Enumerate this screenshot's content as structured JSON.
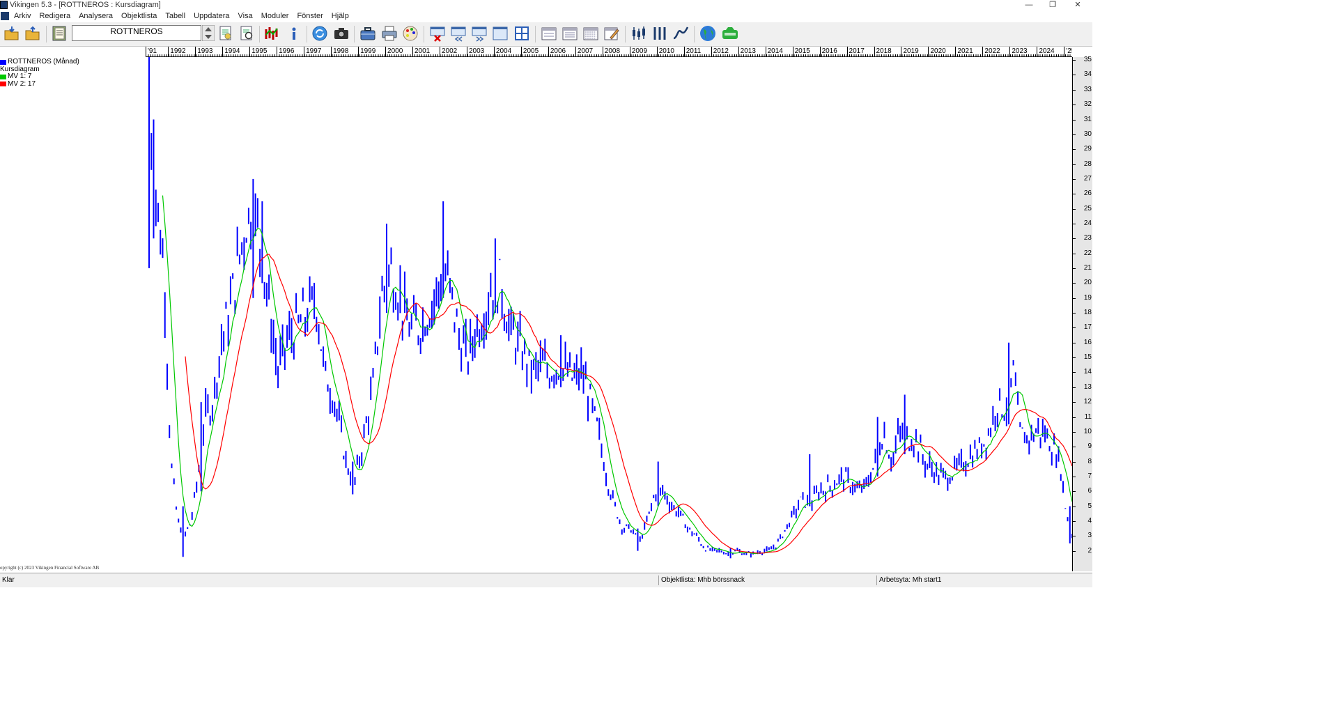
{
  "window": {
    "title": "Vikingen 5.3 - [ROTTNEROS : Kursdiagram]"
  },
  "menu": {
    "items": [
      "Arkiv",
      "Redigera",
      "Analysera",
      "Objektlista",
      "Tabell",
      "Uppdatera",
      "Visa",
      "Moduler",
      "Fönster",
      "Hjälp"
    ]
  },
  "toolbar": {
    "instrument": "ROTTNEROS",
    "icons": [
      "folder-open-icon",
      "folder-up-icon",
      "notebook-icon",
      "list-document-icon",
      "list-star-icon",
      "candles-chart-icon",
      "info-icon",
      "refresh-icon",
      "camera-icon",
      "briefcase-icon",
      "printer-icon",
      "palette-icon",
      "window-close-icon",
      "window-back-icon",
      "window-forward-icon",
      "window-icon",
      "number-grid-icon",
      "calendar-day-icon",
      "calendar-week-icon",
      "calendar-month-icon",
      "calendar-edit-icon",
      "bar-candles-icon",
      "bar-ohlc-icon",
      "line-curve-icon",
      "globe-icon",
      "web-icon"
    ]
  },
  "chart_data": {
    "type": "line",
    "title": "",
    "xlabel": "",
    "ylabel": "",
    "ylim": [
      1,
      36
    ],
    "year_labels": [
      "'91",
      "1992",
      "1993",
      "1994",
      "1995",
      "1996",
      "1997",
      "1998",
      "1999",
      "2000",
      "2001",
      "2002",
      "2003",
      "2004",
      "2005",
      "2006",
      "2007",
      "2008",
      "2009",
      "2010",
      "2011",
      "2012",
      "2013",
      "2014",
      "2015",
      "2016",
      "2017",
      "2018",
      "2019",
      "2020",
      "2021",
      "2022",
      "2023",
      "2024",
      "'25"
    ],
    "y_ticks": [
      2,
      3,
      4,
      5,
      6,
      7,
      8,
      9,
      10,
      11,
      12,
      13,
      14,
      15,
      16,
      17,
      18,
      19,
      20,
      21,
      22,
      23,
      24,
      25,
      26,
      27,
      28,
      29,
      30,
      31,
      32,
      33,
      34,
      35
    ],
    "legend": [
      "ROTTNEROS (Månad)",
      "Kursdiagram",
      "MV 1: 7",
      "MV 2: 17"
    ],
    "colors": {
      "price": "#0000ff",
      "mv1": "#00c800",
      "mv2": "#ff0000"
    },
    "anchors": [
      {
        "t": 1991.1,
        "c": 31
      },
      {
        "t": 1991.3,
        "c": 26
      },
      {
        "t": 1991.6,
        "c": 21
      },
      {
        "t": 1991.85,
        "c": 8
      },
      {
        "t": 1992.1,
        "c": 4
      },
      {
        "t": 1992.35,
        "c": 3
      },
      {
        "t": 1992.6,
        "c": 4
      },
      {
        "t": 1992.85,
        "c": 7
      },
      {
        "t": 1993.1,
        "c": 11
      },
      {
        "t": 1993.4,
        "c": 12
      },
      {
        "t": 1993.7,
        "c": 16
      },
      {
        "t": 1994.0,
        "c": 18
      },
      {
        "t": 1994.3,
        "c": 21
      },
      {
        "t": 1994.6,
        "c": 24
      },
      {
        "t": 1994.9,
        "c": 25
      },
      {
        "t": 1995.2,
        "c": 22
      },
      {
        "t": 1995.5,
        "c": 18
      },
      {
        "t": 1995.8,
        "c": 14
      },
      {
        "t": 1996.1,
        "c": 16
      },
      {
        "t": 1996.5,
        "c": 17
      },
      {
        "t": 1996.9,
        "c": 18
      },
      {
        "t": 1997.2,
        "c": 19
      },
      {
        "t": 1997.5,
        "c": 14
      },
      {
        "t": 1997.9,
        "c": 12
      },
      {
        "t": 1998.3,
        "c": 8
      },
      {
        "t": 1998.6,
        "c": 6.5
      },
      {
        "t": 1998.9,
        "c": 9
      },
      {
        "t": 1999.3,
        "c": 13
      },
      {
        "t": 1999.6,
        "c": 19
      },
      {
        "t": 1999.95,
        "c": 21
      },
      {
        "t": 2000.3,
        "c": 19
      },
      {
        "t": 2000.6,
        "c": 17
      },
      {
        "t": 2001.0,
        "c": 17
      },
      {
        "t": 2001.3,
        "c": 18
      },
      {
        "t": 2001.6,
        "c": 19
      },
      {
        "t": 2001.9,
        "c": 21
      },
      {
        "t": 2002.2,
        "c": 19
      },
      {
        "t": 2002.5,
        "c": 16
      },
      {
        "t": 2002.8,
        "c": 15
      },
      {
        "t": 2003.1,
        "c": 17
      },
      {
        "t": 2003.4,
        "c": 18
      },
      {
        "t": 2003.7,
        "c": 20
      },
      {
        "t": 2004.0,
        "c": 20
      },
      {
        "t": 2004.3,
        "c": 17
      },
      {
        "t": 2004.6,
        "c": 16
      },
      {
        "t": 2004.9,
        "c": 15
      },
      {
        "t": 2005.2,
        "c": 14
      },
      {
        "t": 2005.5,
        "c": 14.5
      },
      {
        "t": 2005.8,
        "c": 14
      },
      {
        "t": 2006.1,
        "c": 14.5
      },
      {
        "t": 2006.4,
        "c": 14
      },
      {
        "t": 2006.7,
        "c": 13.5
      },
      {
        "t": 2007.0,
        "c": 14
      },
      {
        "t": 2007.3,
        "c": 12
      },
      {
        "t": 2007.6,
        "c": 10
      },
      {
        "t": 2007.9,
        "c": 7
      },
      {
        "t": 2008.2,
        "c": 5
      },
      {
        "t": 2008.5,
        "c": 3.5
      },
      {
        "t": 2008.8,
        "c": 3.5
      },
      {
        "t": 2009.1,
        "c": 2.5
      },
      {
        "t": 2009.4,
        "c": 4
      },
      {
        "t": 2009.7,
        "c": 6
      },
      {
        "t": 2010.0,
        "c": 6
      },
      {
        "t": 2010.3,
        "c": 5
      },
      {
        "t": 2010.6,
        "c": 4.5
      },
      {
        "t": 2010.9,
        "c": 3.5
      },
      {
        "t": 2011.2,
        "c": 3
      },
      {
        "t": 2011.5,
        "c": 2.2
      },
      {
        "t": 2011.8,
        "c": 2
      },
      {
        "t": 2012.1,
        "c": 2
      },
      {
        "t": 2012.4,
        "c": 1.8
      },
      {
        "t": 2012.7,
        "c": 2
      },
      {
        "t": 2013.0,
        "c": 1.8
      },
      {
        "t": 2013.3,
        "c": 1.8
      },
      {
        "t": 2013.6,
        "c": 2
      },
      {
        "t": 2013.9,
        "c": 2
      },
      {
        "t": 2014.2,
        "c": 2.5
      },
      {
        "t": 2014.5,
        "c": 3.5
      },
      {
        "t": 2014.8,
        "c": 4.5
      },
      {
        "t": 2015.1,
        "c": 5.5
      },
      {
        "t": 2015.4,
        "c": 5
      },
      {
        "t": 2015.7,
        "c": 6
      },
      {
        "t": 2016.0,
        "c": 6.2
      },
      {
        "t": 2016.3,
        "c": 6.5
      },
      {
        "t": 2016.6,
        "c": 7
      },
      {
        "t": 2016.9,
        "c": 6.5
      },
      {
        "t": 2017.2,
        "c": 6
      },
      {
        "t": 2017.5,
        "c": 6.5
      },
      {
        "t": 2017.8,
        "c": 8
      },
      {
        "t": 2018.1,
        "c": 10
      },
      {
        "t": 2018.4,
        "c": 8
      },
      {
        "t": 2018.7,
        "c": 10
      },
      {
        "t": 2019.0,
        "c": 9.5
      },
      {
        "t": 2019.3,
        "c": 9.5
      },
      {
        "t": 2019.6,
        "c": 8
      },
      {
        "t": 2019.9,
        "c": 7.5
      },
      {
        "t": 2020.2,
        "c": 7
      },
      {
        "t": 2020.5,
        "c": 7
      },
      {
        "t": 2020.8,
        "c": 7.5
      },
      {
        "t": 2021.1,
        "c": 8
      },
      {
        "t": 2021.4,
        "c": 8.5
      },
      {
        "t": 2021.7,
        "c": 9
      },
      {
        "t": 2022.0,
        "c": 10
      },
      {
        "t": 2022.3,
        "c": 12
      },
      {
        "t": 2022.6,
        "c": 11.5
      },
      {
        "t": 2022.9,
        "c": 14
      },
      {
        "t": 2023.1,
        "c": 10
      },
      {
        "t": 2023.4,
        "c": 9.5
      },
      {
        "t": 2023.7,
        "c": 10
      },
      {
        "t": 2024.0,
        "c": 10
      },
      {
        "t": 2024.3,
        "c": 9
      },
      {
        "t": 2024.6,
        "c": 8
      },
      {
        "t": 2024.8,
        "c": 5
      },
      {
        "t": 2025.0,
        "c": 3
      }
    ],
    "spikes": [
      {
        "t": 1991.05,
        "h": 35.5,
        "l": 21
      },
      {
        "t": 1991.25,
        "h": 31,
        "l": 23
      },
      {
        "t": 1992.3,
        "h": 5,
        "l": 1.6
      },
      {
        "t": 1993.0,
        "h": 12,
        "l": 6
      },
      {
        "t": 1994.85,
        "h": 27,
        "l": 19
      },
      {
        "t": 1995.25,
        "h": 25.5,
        "l": 20
      },
      {
        "t": 1998.55,
        "h": 8,
        "l": 5.8
      },
      {
        "t": 1999.8,
        "h": 24,
        "l": 18
      },
      {
        "t": 2001.85,
        "h": 25.5,
        "l": 19
      },
      {
        "t": 2003.8,
        "h": 23,
        "l": 18
      },
      {
        "t": 2006.2,
        "h": 16.5,
        "l": 13
      },
      {
        "t": 2009.05,
        "h": 3.5,
        "l": 2
      },
      {
        "t": 2009.8,
        "h": 8,
        "l": 5
      },
      {
        "t": 2012.5,
        "h": 2.2,
        "l": 1.5
      },
      {
        "t": 2015.35,
        "h": 8.5,
        "l": 5
      },
      {
        "t": 2017.85,
        "h": 11,
        "l": 7
      },
      {
        "t": 2018.85,
        "h": 12.5,
        "l": 8.5
      },
      {
        "t": 2022.75,
        "h": 16,
        "l": 10.5
      },
      {
        "t": 2025.0,
        "h": 5,
        "l": 2.5
      }
    ]
  },
  "status": {
    "left": "Klar",
    "objektlista": "Objektlista: Mhb börssnack",
    "arbetsyta": "Arbetsyta: Mh start1"
  },
  "copyright": "opyright (c) 2023 Vikingen Financial Software AB"
}
